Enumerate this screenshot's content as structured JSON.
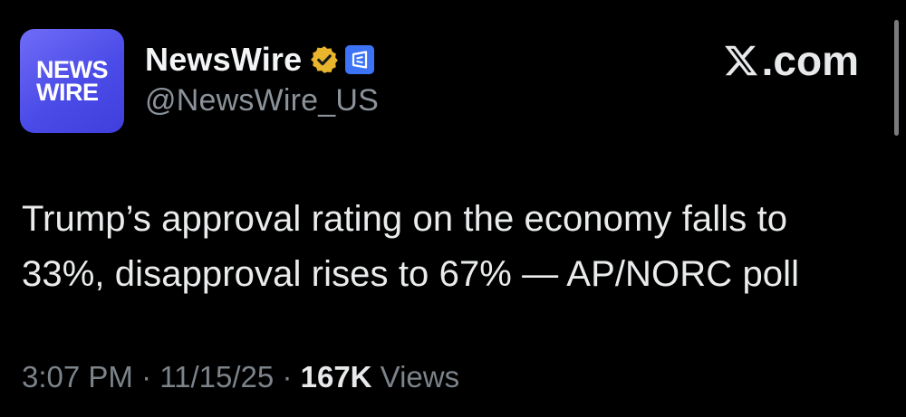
{
  "avatar": {
    "line1": "NEWS",
    "line2": "WIRE",
    "color_top": "#6f6cf6",
    "color_bottom": "#3f3fdc"
  },
  "account": {
    "display_name": "NewsWire",
    "handle": "@NewsWire_US",
    "verified_badge_color": "#e8b52d",
    "affiliate_badge_color": "#3d74f6"
  },
  "site": {
    "label": ".com",
    "logo_icon": "x-logo-icon"
  },
  "post": {
    "text_lines": [
      "Trump’s approval rating on the economy falls to",
      "33%, disapproval rises to 67% — AP/NORC poll"
    ]
  },
  "meta": {
    "time": "3:07 PM",
    "separator": "·",
    "date": "11/15/25",
    "views_count": "167K",
    "views_label": "Views"
  },
  "colors": {
    "background": "#000000",
    "primary_text": "#e7e9ea",
    "secondary_text": "#7c838a"
  }
}
